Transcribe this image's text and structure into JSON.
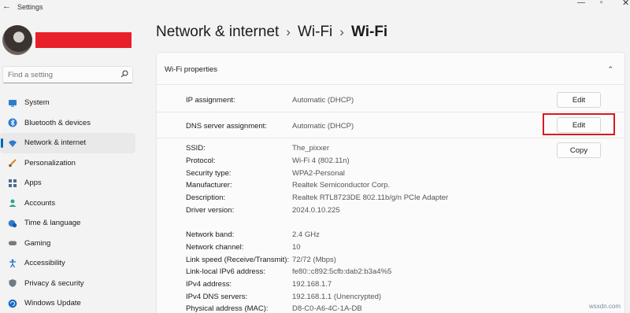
{
  "window": {
    "title": "Settings",
    "back_glyph": "←",
    "minimize_glyph": "—",
    "maximize_glyph": "▫",
    "close_glyph": "✕"
  },
  "search": {
    "placeholder": "Find a setting"
  },
  "sidebar": {
    "items": [
      {
        "label": "System",
        "icon": "monitor-icon"
      },
      {
        "label": "Bluetooth & devices",
        "icon": "bluetooth-icon"
      },
      {
        "label": "Network & internet",
        "icon": "wifi-icon",
        "active": true
      },
      {
        "label": "Personalization",
        "icon": "brush-icon"
      },
      {
        "label": "Apps",
        "icon": "apps-icon"
      },
      {
        "label": "Accounts",
        "icon": "person-icon"
      },
      {
        "label": "Time & language",
        "icon": "globe-clock-icon"
      },
      {
        "label": "Gaming",
        "icon": "gamepad-icon"
      },
      {
        "label": "Accessibility",
        "icon": "accessibility-icon"
      },
      {
        "label": "Privacy & security",
        "icon": "shield-icon"
      },
      {
        "label": "Windows Update",
        "icon": "sync-icon"
      }
    ]
  },
  "breadcrumb": {
    "part1": "Network & internet",
    "part2": "Wi-Fi",
    "part3": "Wi-Fi",
    "separator": "›"
  },
  "panel": {
    "title": "Wi-Fi properties",
    "collapse_glyph": "⌃",
    "ip_assignment": {
      "label": "IP assignment:",
      "value": "Automatic (DHCP)",
      "button": "Edit"
    },
    "dns_assignment": {
      "label": "DNS server assignment:",
      "value": "Automatic (DHCP)",
      "button": "Edit"
    },
    "copy_button": "Copy",
    "properties": [
      {
        "label": "SSID:",
        "value": "The_pixxer"
      },
      {
        "label": "Protocol:",
        "value": "Wi-Fi 4 (802.11n)"
      },
      {
        "label": "Security type:",
        "value": "WPA2-Personal"
      },
      {
        "label": "Manufacturer:",
        "value": "Realtek Semiconductor Corp."
      },
      {
        "label": "Description:",
        "value": "Realtek RTL8723DE 802.11b/g/n PCIe Adapter"
      },
      {
        "label": "Driver version:",
        "value": "2024.0.10.225"
      },
      {
        "label": "Network band:",
        "value": "2.4 GHz"
      },
      {
        "label": "Network channel:",
        "value": "10"
      },
      {
        "label": "Link speed (Receive/Transmit):",
        "value": "72/72 (Mbps)"
      },
      {
        "label": "Link-local IPv6 address:",
        "value": "fe80::c892:5cfb:dab2:b3a4%5"
      },
      {
        "label": "IPv4 address:",
        "value": "192.168.1.7"
      },
      {
        "label": "IPv4 DNS servers:",
        "value": "192.168.1.1 (Unencrypted)"
      },
      {
        "label": "Physical address (MAC):",
        "value": "D8-C0-A6-4C-1A-DB"
      }
    ]
  },
  "watermark": "wsxdn.com",
  "colors": {
    "accent": "#0067c0",
    "highlight": "#d7191f",
    "redaction": "#e8202a"
  }
}
